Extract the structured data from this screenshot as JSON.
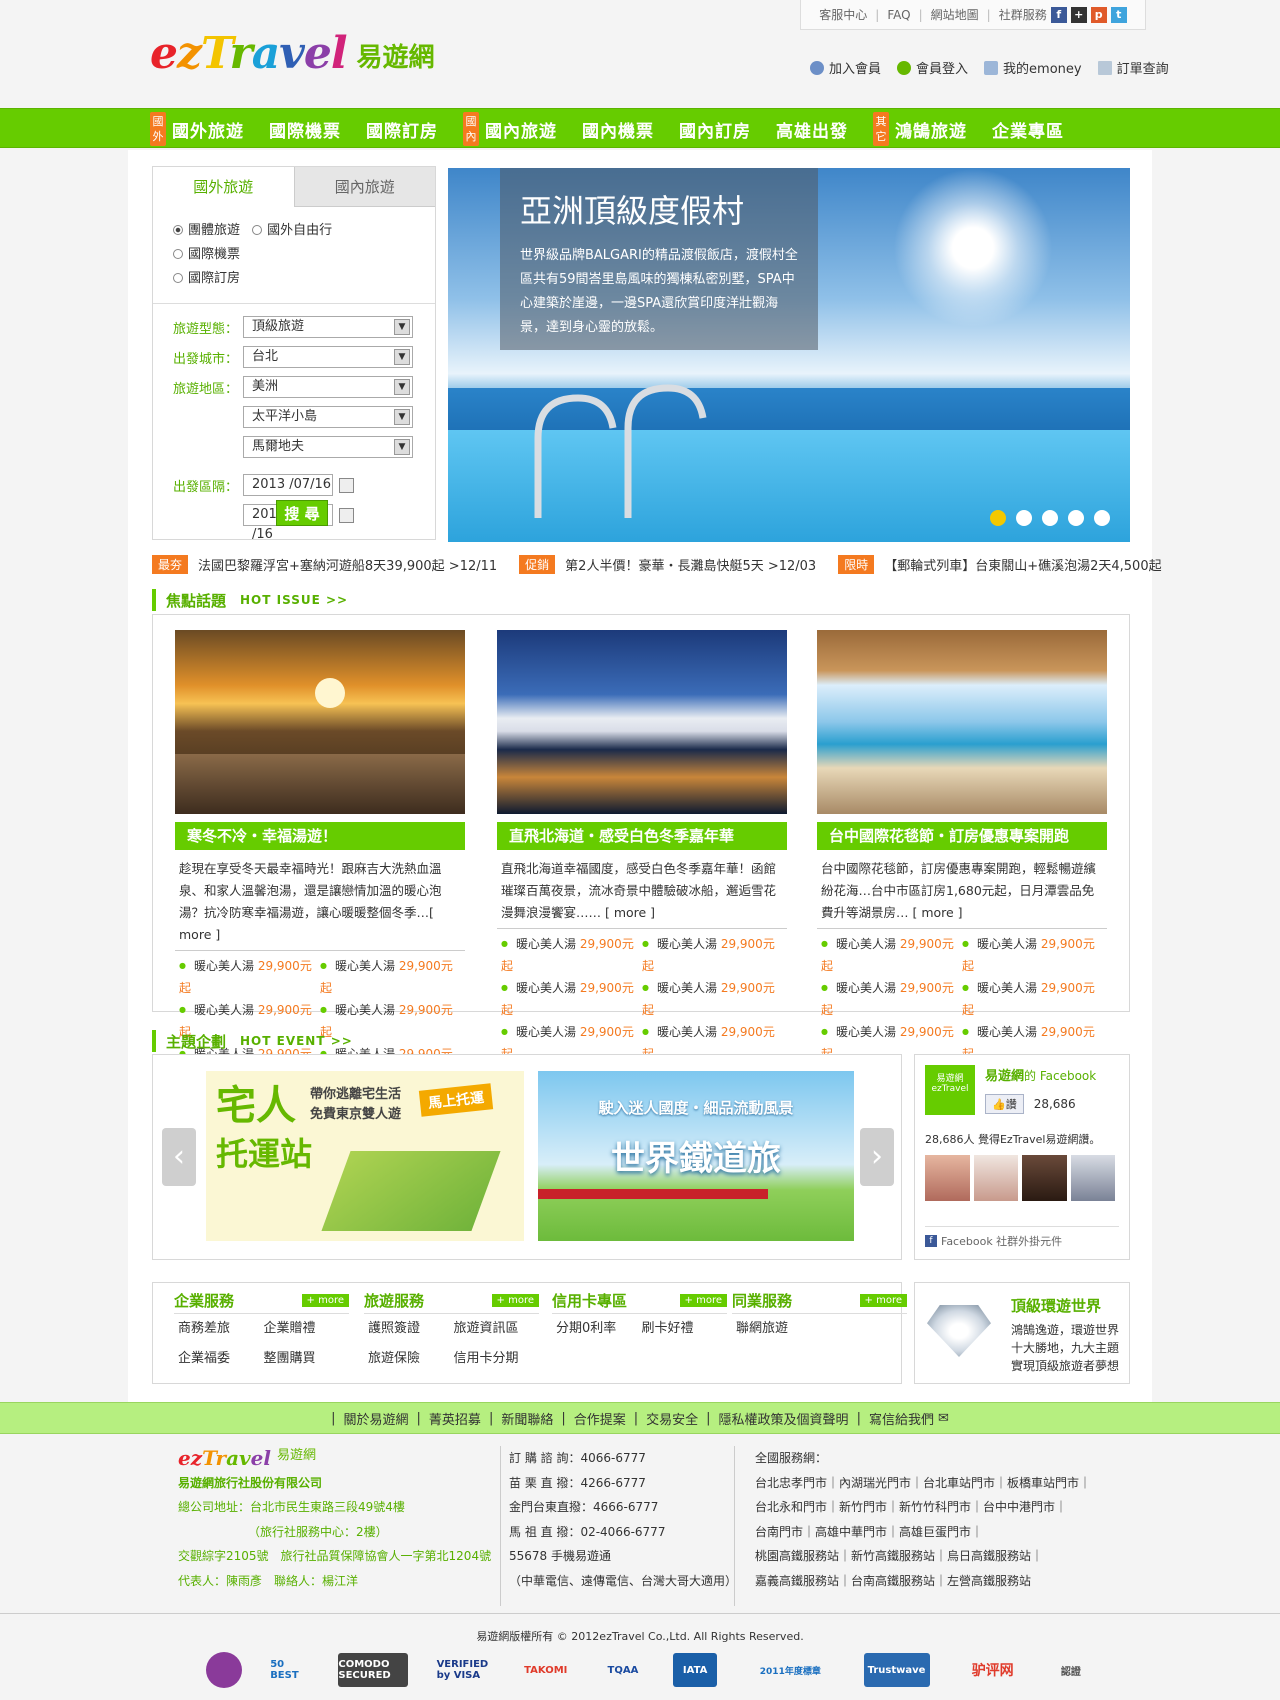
{
  "top_util": {
    "links": [
      "客服中心",
      "FAQ",
      "網站地圖",
      "社群服務"
    ],
    "social_icons": [
      {
        "icon": "facebook-icon",
        "color": "#3b5998",
        "glyph": "f"
      },
      {
        "icon": "plus-icon",
        "color": "#333333",
        "glyph": "+"
      },
      {
        "icon": "plurk-icon",
        "color": "#e05a2a",
        "glyph": "p"
      },
      {
        "icon": "twitter-icon",
        "color": "#3fa4dd",
        "glyph": "t"
      }
    ]
  },
  "logo": {
    "en": "ezTravel",
    "cn": "易遊網"
  },
  "member": {
    "join": "加入會員",
    "login": "會員登入",
    "emoney": "我的emoney",
    "order": "訂單查詢"
  },
  "nav": {
    "tag1": "國外",
    "tag2": "國內",
    "tag3": "其它",
    "group1": [
      "國外旅遊",
      "國際機票",
      "國際訂房"
    ],
    "group2": [
      "國內旅遊",
      "國內機票",
      "國內訂房",
      "高雄出發"
    ],
    "group3": [
      "鴻鵠旅遊",
      "企業專區"
    ]
  },
  "search": {
    "tab_active": "國外旅遊",
    "tab_inactive": "國內旅遊",
    "radios": [
      "團體旅遊",
      "國外自由行",
      "國際機票",
      "國際訂房"
    ],
    "label_type": "旅遊型態：",
    "val_type": "頂級旅遊",
    "label_city": "出發城市：",
    "val_city": "台北",
    "label_region": "旅遊地區：",
    "val_region1": "美洲",
    "val_region2": "太平洋小島",
    "val_region3": "馬爾地夫",
    "label_date": "出發區隔：",
    "date_from": "2013 /07/16",
    "date_to": "2013 /08 /16",
    "button": "搜 尋"
  },
  "banner": {
    "title": "亞洲頂級度假村",
    "desc": "世界級品牌BALGARI的精品渡假飯店，渡假村全區共有59間峇里島風味的獨棟私密別墅，SPA中心建築於崖邊，一邊SPA還欣賞印度洋壯觀海景，達到身心靈的放鬆。"
  },
  "ticker": [
    {
      "tag": "最夯",
      "text": "法國巴黎羅浮宮+塞納河遊船8天39,900起 >12/11"
    },
    {
      "tag": "促銷",
      "text": "第2人半價！豪華・長灘島快艇5天 >12/03"
    },
    {
      "tag": "限時",
      "text": "【郵輪式列車】台東關山+礁溪泡湯2天4,500起"
    }
  ],
  "hot_issue": {
    "cn": "焦點話題",
    "en": "HOT ISSUE >>",
    "cards": [
      {
        "title": "寒冬不冷・幸福湯遊！",
        "desc": "趁現在享受冬天最幸福時光！跟麻吉大洗熱血溫泉、和家人溫馨泡湯，還是讓戀情加溫的暖心泡湯？抗冷防寒幸福湯遊，讓心暖暖整個冬季…[ more ]"
      },
      {
        "title": "直飛北海道・感受白色冬季嘉年華",
        "desc": "直飛北海道幸福國度，感受白色冬季嘉年華！函館璀璨百萬夜景，流冰奇景中體驗破冰船，邂逅雪花漫舞浪漫饗宴…… [ more ]"
      },
      {
        "title": "台中國際花毯節・訂房優惠專案開跑",
        "desc": "台中國際花毯節，訂房優惠專案開跑，輕鬆暢遊繽紛花海…台中市區訂房1,680元起，日月潭雲品免費升等湖景房… [ more ]"
      }
    ],
    "item_name": "暖心美人湯",
    "item_price": "29,900元起"
  },
  "hot_event": {
    "cn": "主題企劃",
    "en": "HOT EVENT >>",
    "ev1": {
      "sub1": "帶你逃離宅生活",
      "sub2": "免費東京雙人遊",
      "main1": "宅人",
      "main2": "托運站",
      "tag": "馬上托運"
    },
    "ev2": {
      "sub": "駛入迷人國度・細品流動風景",
      "main": "世界鐵道旅"
    }
  },
  "facebook": {
    "brand": "易遊網",
    "suffix": "的 Facebook",
    "like": "讚",
    "count": "28,686",
    "people": "28,686人 覺得EzTravel易遊網讚。",
    "plugin": "Facebook 社群外掛元件",
    "logo_text": "易遊網 ezTravel"
  },
  "services": [
    {
      "name": "企業服務",
      "more": "+ more",
      "items": [
        "商務差旅",
        "企業贈禮",
        "企業福委",
        "整團購買"
      ]
    },
    {
      "name": "旅遊服務",
      "more": "+ more",
      "items": [
        "護照簽證",
        "旅遊資訊區",
        "旅遊保險",
        "信用卡分期"
      ]
    },
    {
      "name": "信用卡專區",
      "more": "+ more",
      "items": [
        "分期0利率",
        "刷卡好禮"
      ]
    },
    {
      "name": "同業服務",
      "more": "+ more",
      "items": [
        "聯網旅遊"
      ]
    }
  ],
  "promo": {
    "title": "頂級環遊世界",
    "desc": "鴻鵠逸遊，環遊世界十大勝地，九大主題實現頂級旅遊者夢想"
  },
  "footer_links": [
    "關於易遊網",
    "菁英招募",
    "新聞聯絡",
    "合作提案",
    "交易安全",
    "隱私權政策及個資聲明",
    "寫信給我們"
  ],
  "company": {
    "logo_en": "ezTravel",
    "logo_cn": "易遊網",
    "name": "易遊網旅行社股份有限公司",
    "addr": "總公司地址：台北市民生東路三段49號4樓",
    "center": "（旅行社服務中心：2樓）",
    "license": "交觀綜字2105號　旅行社品質保障協會人一字第北1204號",
    "rep": "代表人：陳雨彥　聯絡人：楊江洋"
  },
  "phones": [
    "訂 購 諮 詢：4066-6777",
    "苗 栗 直 撥：4266-6777",
    "金門台東直撥：4666-6777",
    "馬 祖 直 撥：02-4066-6777",
    "55678 手機易遊通",
    "（中華電信、遠傳電信、台灣大哥大適用）"
  ],
  "stores": [
    "全國服務網：",
    "台北忠孝門市｜內湖瑞光門市｜台北車站門市｜板橋車站門市｜",
    "台北永和門市｜新竹門市｜新竹竹科門市｜台中中港門市｜",
    "台南門市｜高雄中華門市｜高雄巨蛋門市｜",
    "桃園高鐵服務站｜新竹高鐵服務站｜烏日高鐵服務站｜",
    "嘉義高鐵服務站｜台南高鐵服務站｜左營高鐵服務站"
  ],
  "copyright": "易遊網版權所有 © 2012ezTravel Co.,Ltd. All Rights Reserved.",
  "badges": [
    "50 BEST",
    "COMODO SECURED",
    "VERIFIED by VISA",
    "TAKOMI",
    "TQAA",
    "IATA",
    "2011年度標章",
    "Trustwave",
    "驴评网",
    "認證"
  ]
}
